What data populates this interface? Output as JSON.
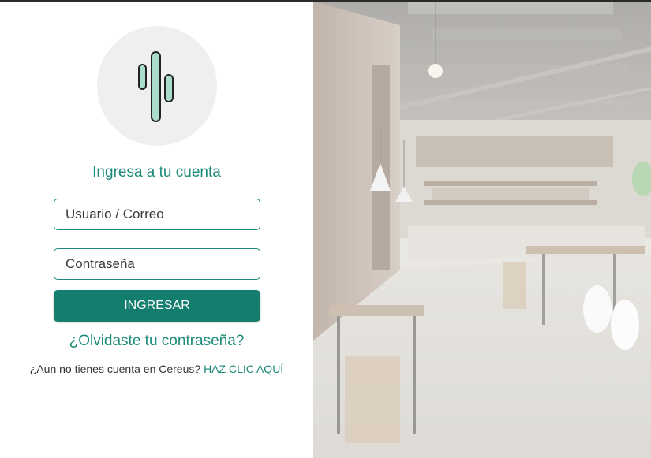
{
  "login": {
    "title": "Ingresa a tu cuenta",
    "username_placeholder": "Usuario / Correo",
    "password_placeholder": "Contraseña",
    "submit_label": "INGRESAR",
    "forgot_label": "¿Olvidaste tu contraseña?",
    "signup_prompt": "¿Aun no tienes cuenta en Cereus?",
    "signup_link": "HAZ CLIC AQUÍ"
  },
  "colors": {
    "accent": "#1b8a79",
    "button": "#137d6e",
    "logo_green": "#a9dccd",
    "logo_circle": "#efefef"
  },
  "icons": {
    "logo": "cactus-logo-icon",
    "background": "restaurant-interior-photo"
  }
}
